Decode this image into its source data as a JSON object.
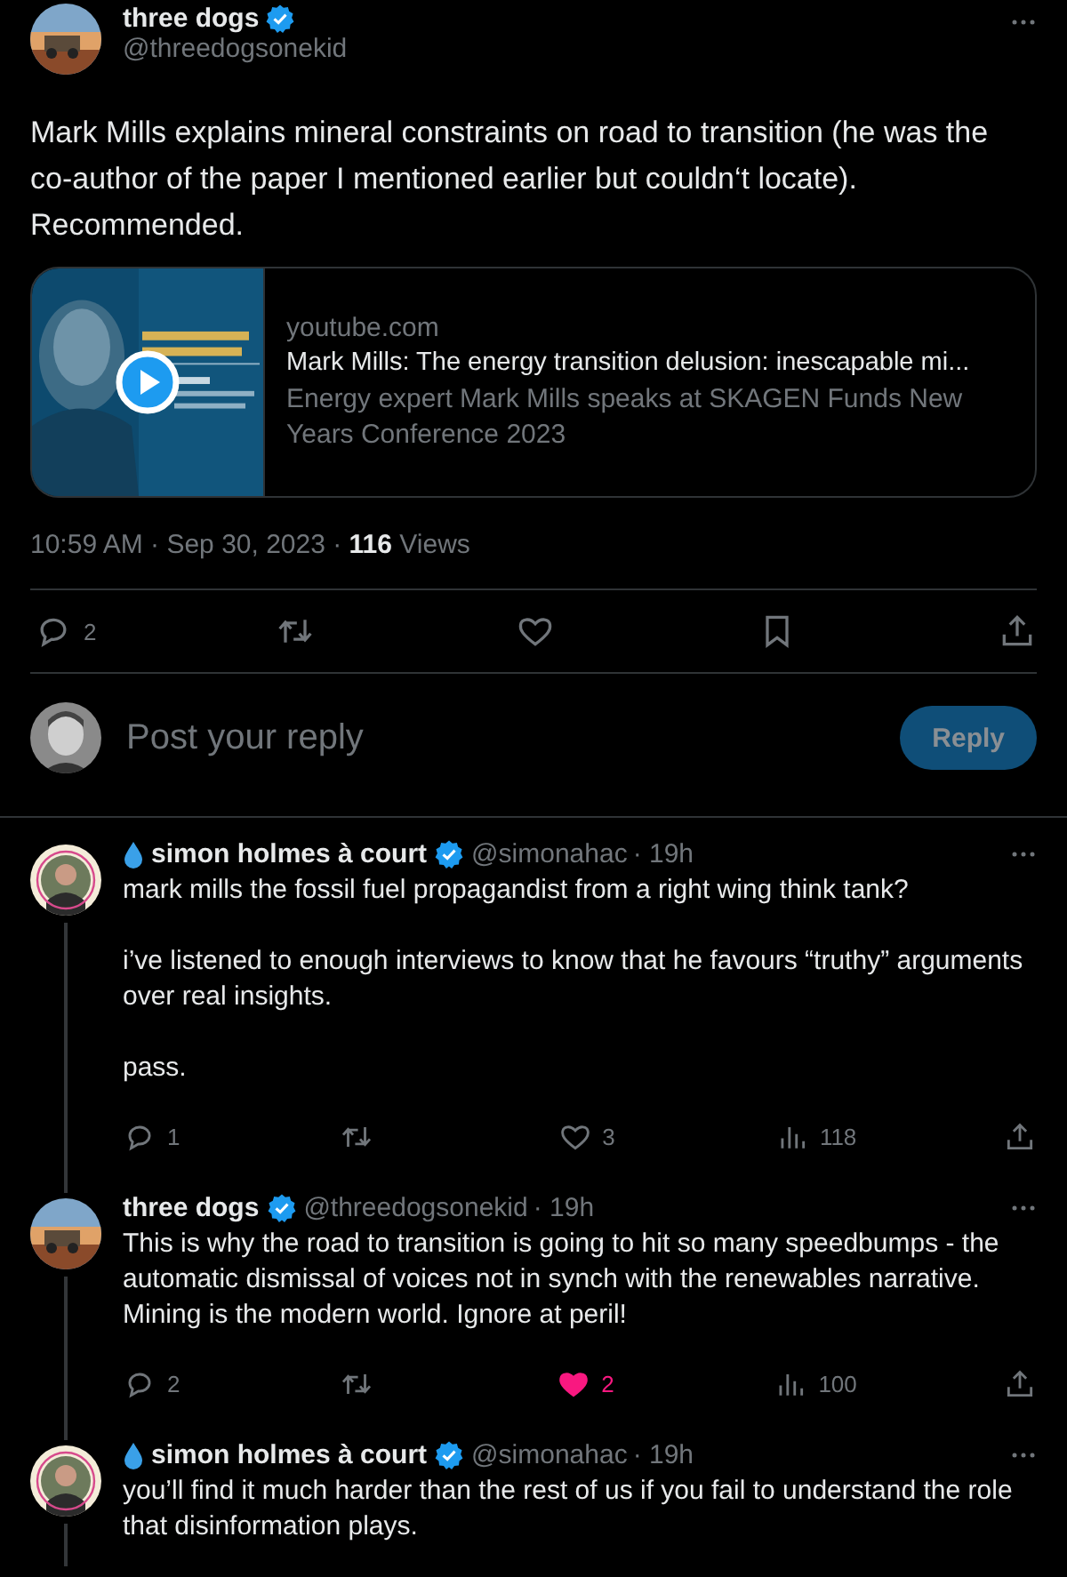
{
  "tweet": {
    "author": "three dogs",
    "verified": true,
    "handle": "@threedogsonekid",
    "text": "Mark Mills explains mineral constraints on road to transition (he was the co-author of the paper I mentioned earlier but couldn‘t locate). Recommended.",
    "card": {
      "domain": "youtube.com",
      "title": "Mark Mills: The energy transition delusion: inescapable mi...",
      "description": "Energy expert Mark Mills speaks at SKAGEN Funds New Years Conference 2023"
    },
    "time": "10:59 AM · Sep 30, 2023 · ",
    "views": "116",
    "views_label": " Views",
    "actions": [
      {
        "kind": "reply",
        "count": "2"
      },
      {
        "kind": "retweet"
      },
      {
        "kind": "like",
        "liked": false
      },
      {
        "kind": "bookmark"
      },
      {
        "kind": "share"
      }
    ]
  },
  "composer": {
    "placeholder": "Post your reply",
    "button": "Reply",
    "disabled": true
  },
  "replies": [
    {
      "droplet": true,
      "author": "simon holmes à court",
      "verified": true,
      "handle": "@simonahac",
      "age": "· 19h",
      "connected": true,
      "paragraphs": [
        "mark mills the fossil fuel propagandist from a right wing think tank?",
        "i’ve listened to enough interviews to know that he favours “truthy” arguments over real insights.",
        "pass."
      ],
      "actions": [
        {
          "kind": "reply",
          "count": "1"
        },
        {
          "kind": "retweet"
        },
        {
          "kind": "like",
          "count": "3",
          "liked": false
        },
        {
          "kind": "views",
          "count": "118"
        },
        {
          "kind": "share"
        }
      ]
    },
    {
      "droplet": false,
      "author": "three dogs",
      "verified": true,
      "handle": "@threedogsonekid",
      "age": "· 19h",
      "connected": true,
      "paragraphs": [
        "This is why the road to transition is going to hit so many speedbumps - the automatic dismissal of voices not in synch with the renewables narrative. Mining is the modern world. Ignore at peril!"
      ],
      "actions": [
        {
          "kind": "reply",
          "count": "2"
        },
        {
          "kind": "retweet"
        },
        {
          "kind": "like",
          "count": "2",
          "liked": true
        },
        {
          "kind": "views",
          "count": "100"
        },
        {
          "kind": "share"
        }
      ]
    },
    {
      "droplet": true,
      "author": "simon holmes à court",
      "verified": true,
      "handle": "@simonahac",
      "age": "· 19h",
      "connected": true,
      "paragraphs": [
        "you’ll find it much harder than the rest of us if you fail to understand the role that disinformation plays."
      ]
    }
  ]
}
